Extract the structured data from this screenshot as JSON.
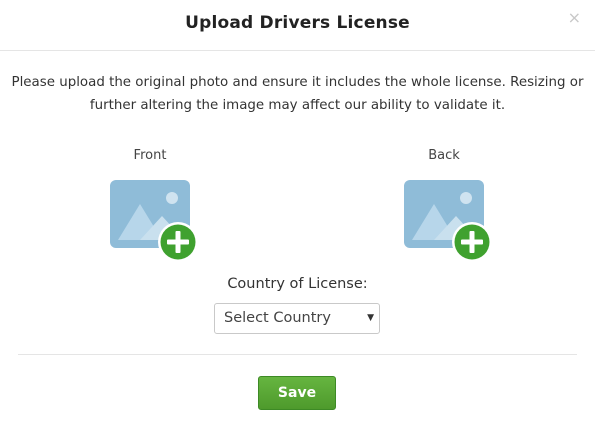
{
  "modal": {
    "title": "Upload Drivers License",
    "close_icon": "close-icon",
    "close_glyph": "×"
  },
  "instructions": "Please upload the original photo and ensure it includes the whole license. Resizing or further altering the image may affect our ability to validate it.",
  "uploads": [
    {
      "label": "Front",
      "icon": "image-add-icon"
    },
    {
      "label": "Back",
      "icon": "image-add-icon"
    }
  ],
  "country": {
    "label": "Country of License:",
    "selected": "Select Country",
    "caret_glyph": "▼"
  },
  "actions": {
    "save_label": "Save"
  },
  "colors": {
    "image_tile": "#8fbcd8",
    "image_mountain": "#b7d6ea",
    "add_badge": "#3fa12f",
    "save_button": "#5aa737",
    "divider": "#e5e5e5"
  }
}
